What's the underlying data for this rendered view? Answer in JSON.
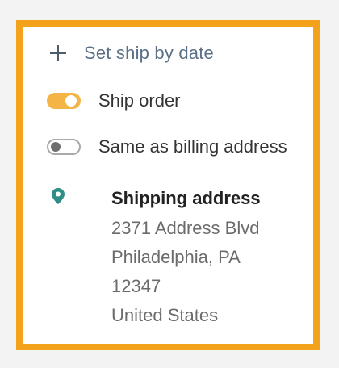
{
  "actions": {
    "set_ship_by_date_label": "Set ship by date"
  },
  "toggles": {
    "ship_order": {
      "label": "Ship order",
      "on": true
    },
    "same_as_billing": {
      "label": "Same as billing address",
      "on": false
    }
  },
  "shipping_address": {
    "title": "Shipping address",
    "lines": [
      "2371 Address Blvd",
      "Philadelphia, PA",
      "12347",
      "United States"
    ]
  },
  "colors": {
    "panel_border": "#f2a21b",
    "toggle_on": "#f5b546",
    "link": "#5b6f86",
    "pin": "#2f8f86"
  },
  "icons": {
    "plus": "plus-icon",
    "pin": "location-pin-icon"
  }
}
